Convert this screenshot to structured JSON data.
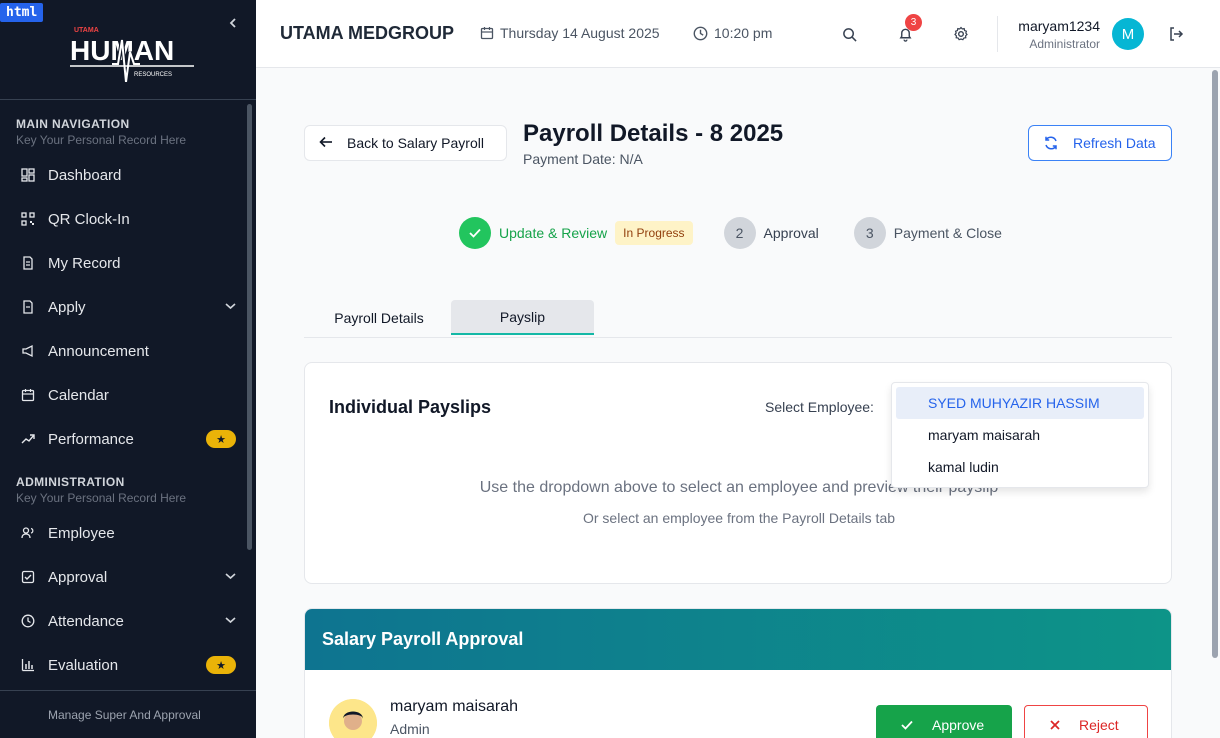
{
  "sidebar": {
    "badge": "html",
    "logo": {
      "top": "UTAMA",
      "main": "HUMAN",
      "sub": "RESOURCES"
    },
    "sections": [
      {
        "title": "MAIN NAVIGATION",
        "subtitle": "Key Your Personal Record Here"
      },
      {
        "title": "ADMINISTRATION",
        "subtitle": "Key Your Personal Record Here"
      }
    ],
    "main_items": [
      {
        "label": "Dashboard",
        "icon": "dashboard-icon"
      },
      {
        "label": "QR Clock-In",
        "icon": "qr-icon"
      },
      {
        "label": "My Record",
        "icon": "document-icon"
      },
      {
        "label": "Apply",
        "icon": "form-icon",
        "has_chevron": true
      },
      {
        "label": "Announcement",
        "icon": "megaphone-icon"
      },
      {
        "label": "Calendar",
        "icon": "calendar-icon"
      },
      {
        "label": "Performance",
        "icon": "trending-icon",
        "badge": "★"
      }
    ],
    "admin_items": [
      {
        "label": "Employee",
        "icon": "users-icon"
      },
      {
        "label": "Approval",
        "icon": "check-square-icon",
        "has_chevron": true
      },
      {
        "label": "Attendance",
        "icon": "clock-icon",
        "has_chevron": true
      },
      {
        "label": "Evaluation",
        "icon": "bar-chart-icon",
        "badge": "★"
      }
    ],
    "footer": "Manage Super And Approval"
  },
  "header": {
    "brand": "UTAMA MEDGROUP",
    "date": "Thursday 14 August 2025",
    "time": "10:20 pm",
    "notification_count": "3",
    "user_name": "maryam1234",
    "user_role": "Administrator",
    "avatar_initial": "M"
  },
  "page": {
    "back_label": "Back to Salary Payroll",
    "title": "Payroll Details - 8 2025",
    "payment_date": "Payment Date: N/A",
    "refresh_label": "Refresh Data",
    "steps": [
      {
        "num": "✓",
        "label": "Update & Review",
        "status": "In Progress"
      },
      {
        "num": "2",
        "label": "Approval"
      },
      {
        "num": "3",
        "label": "Payment & Close"
      }
    ],
    "tabs": [
      "Payroll Details",
      "Payslip"
    ],
    "active_tab": "Payslip"
  },
  "payslips": {
    "title": "Individual Payslips",
    "select_label": "Select Employee:",
    "empty_main": "Use the dropdown above to select an employee and preview their payslip",
    "empty_sub": "Or select an employee from the Payroll Details tab",
    "options": [
      "SYED MUHYAZIR HASSIM",
      "maryam maisarah",
      "kamal ludin"
    ],
    "highlighted_option": "SYED MUHYAZIR HASSIM"
  },
  "approval": {
    "title": "Salary Payroll Approval",
    "approver_name": "maryam maisarah",
    "approver_role": "Admin",
    "approve_label": "Approve",
    "reject_label": "Reject"
  },
  "colors": {
    "sidebar_bg": "#111827",
    "accent_green": "#22c55e",
    "accent_blue": "#2563eb",
    "approval_header": "#0e7490",
    "reject_red": "#ef4444"
  }
}
